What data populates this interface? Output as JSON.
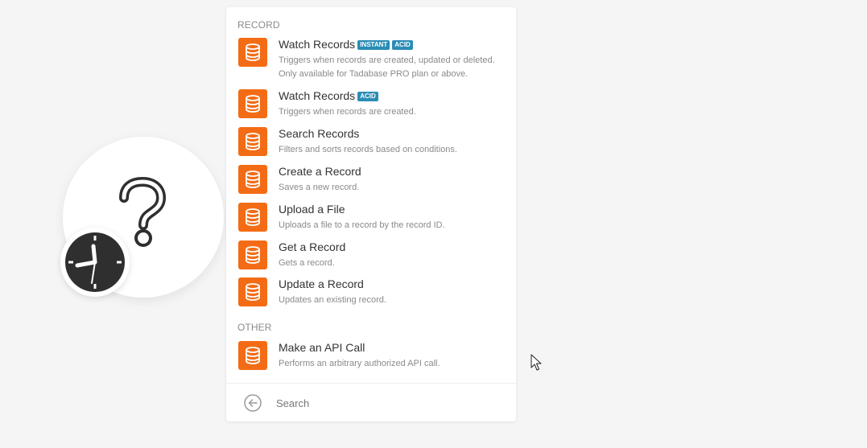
{
  "groups": {
    "record": "RECORD",
    "other": "OTHER"
  },
  "items": [
    {
      "title": "Watch Records",
      "badges": [
        "INSTANT",
        "ACID"
      ],
      "desc": "Triggers when records are created, updated or deleted.",
      "desc2": "Only available for Tadabase PRO plan or above."
    },
    {
      "title": "Watch Records",
      "badges": [
        "ACID"
      ],
      "desc": "Triggers when records are created."
    },
    {
      "title": "Search Records",
      "desc": "Filters and sorts records based on conditions."
    },
    {
      "title": "Create a Record",
      "desc": "Saves a new record."
    },
    {
      "title": "Upload a File",
      "desc": "Uploads a file to a record by the record ID."
    },
    {
      "title": "Get a Record",
      "desc": "Gets a record."
    },
    {
      "title": "Update a Record",
      "desc": "Updates an existing record."
    },
    {
      "title": "Make an API Call",
      "desc": "Performs an arbitrary authorized API call."
    }
  ],
  "search": {
    "placeholder": "Search",
    "value": ""
  },
  "icons": {
    "module": "database-icon",
    "back": "back-arrow-icon",
    "placeholder_bubble": "question-mark-icon",
    "schedule": "clock-icon",
    "cursor": "mouse-pointer-icon"
  },
  "colors": {
    "module_icon_bg": "#f36c15",
    "badge_bg": "#2a8cb5",
    "background": "#f5f5f5",
    "clock": "#2f2f2f"
  }
}
